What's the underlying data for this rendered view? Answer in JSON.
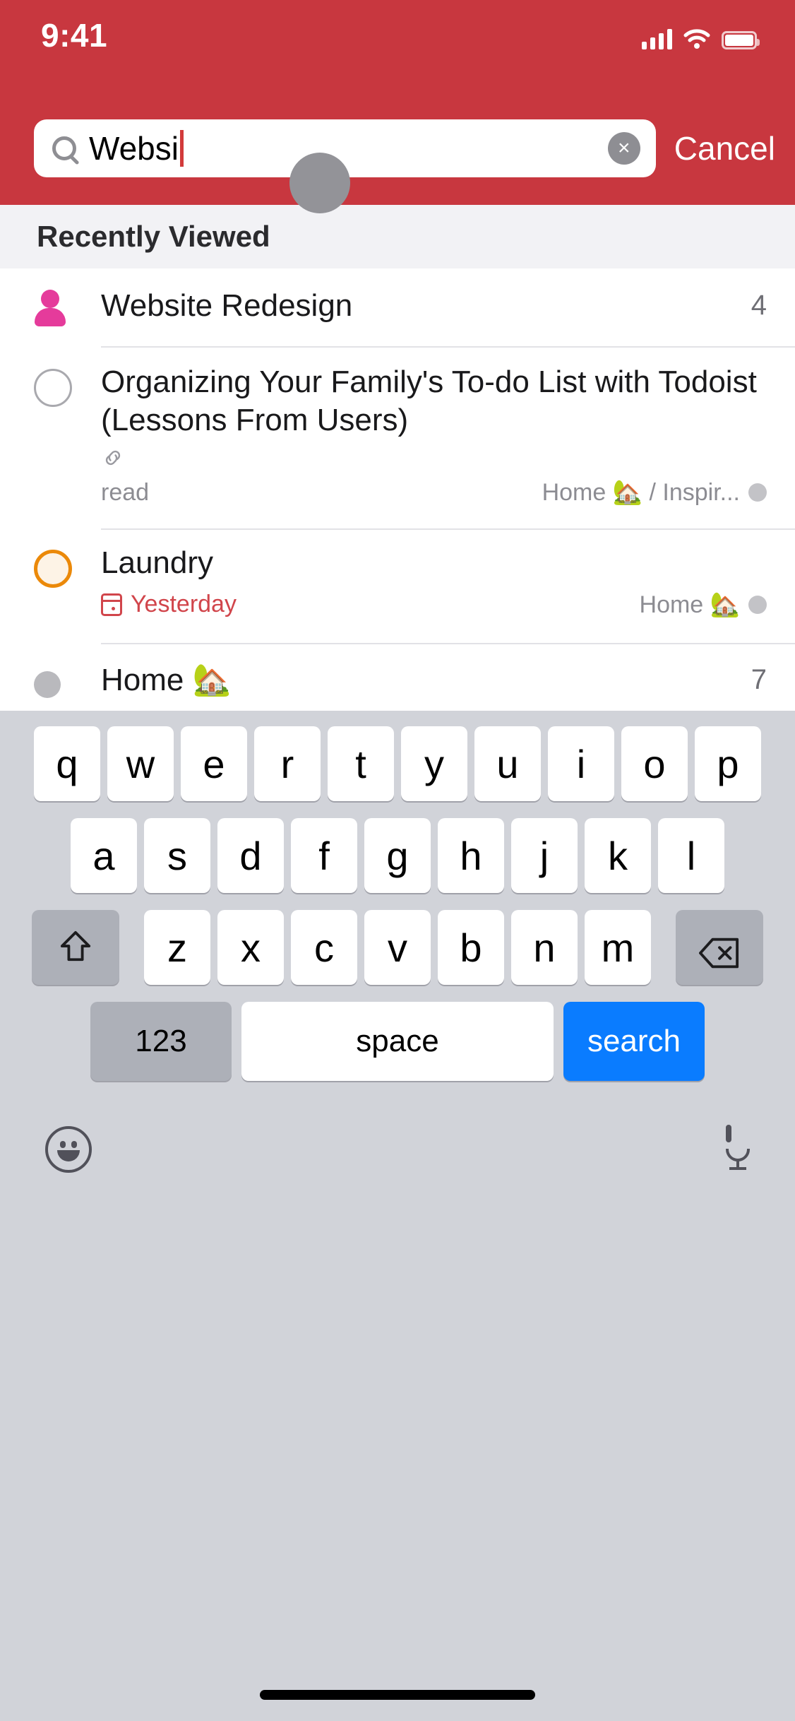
{
  "status_bar": {
    "time": "9:41",
    "cellular_icon": "cellular-bars-icon",
    "wifi_icon": "wifi-icon",
    "battery_icon": "battery-icon"
  },
  "theme": {
    "header_red": "#c8373f",
    "accent_blue": "#0a7cff",
    "due_red": "#d1454b",
    "person_pink": "#e53b9b",
    "checkbox_orange": "#eb8909",
    "keyboard_bg": "#d1d3d9"
  },
  "search": {
    "value": "Websi",
    "placeholder": "Search",
    "search_icon": "search-icon",
    "clear_icon": "clear-circle-icon",
    "clear_glyph": "×",
    "cancel_label": "Cancel"
  },
  "section": {
    "title": "Recently Viewed"
  },
  "results": [
    {
      "lead_icon": "person-icon",
      "lead_type": "person",
      "title": "Website Redesign",
      "count": "4",
      "meta_left": null,
      "meta_right": null,
      "due": null,
      "link_icon": null
    },
    {
      "lead_icon": "task-checkbox-icon",
      "lead_type": "checkbox",
      "title": "Organizing Your Family's To-do List with Todoist (Lessons From Users)",
      "count": null,
      "link_icon": "link-icon",
      "link_glyph": "🔗",
      "meta_left": "read",
      "meta_right": "Home 🏡 / Inspir...",
      "meta_right_dot": "project-color-dot",
      "due": null
    },
    {
      "lead_icon": "task-checkbox-priority-icon",
      "lead_type": "checkbox-orange",
      "title": "Laundry",
      "count": null,
      "due": "Yesterday",
      "due_icon": "calendar-icon",
      "meta_left": null,
      "meta_right": "Home 🏡",
      "meta_right_dot": "project-color-dot"
    },
    {
      "lead_icon": "project-dot-icon",
      "lead_type": "dot",
      "title": "Home 🏡",
      "count": "7",
      "meta_left": null,
      "meta_right": null,
      "due": null
    }
  ],
  "keyboard": {
    "row1": [
      "q",
      "w",
      "e",
      "r",
      "t",
      "y",
      "u",
      "i",
      "o",
      "p"
    ],
    "row2": [
      "a",
      "s",
      "d",
      "f",
      "g",
      "h",
      "j",
      "k",
      "l"
    ],
    "row3": [
      "z",
      "x",
      "c",
      "v",
      "b",
      "n",
      "m"
    ],
    "shift_icon": "shift-key-icon",
    "delete_icon": "delete-key-icon",
    "numbers_label": "123",
    "space_label": "space",
    "search_label": "search",
    "emoji_icon": "emoji-key-icon",
    "mic_icon": "dictation-mic-icon"
  }
}
